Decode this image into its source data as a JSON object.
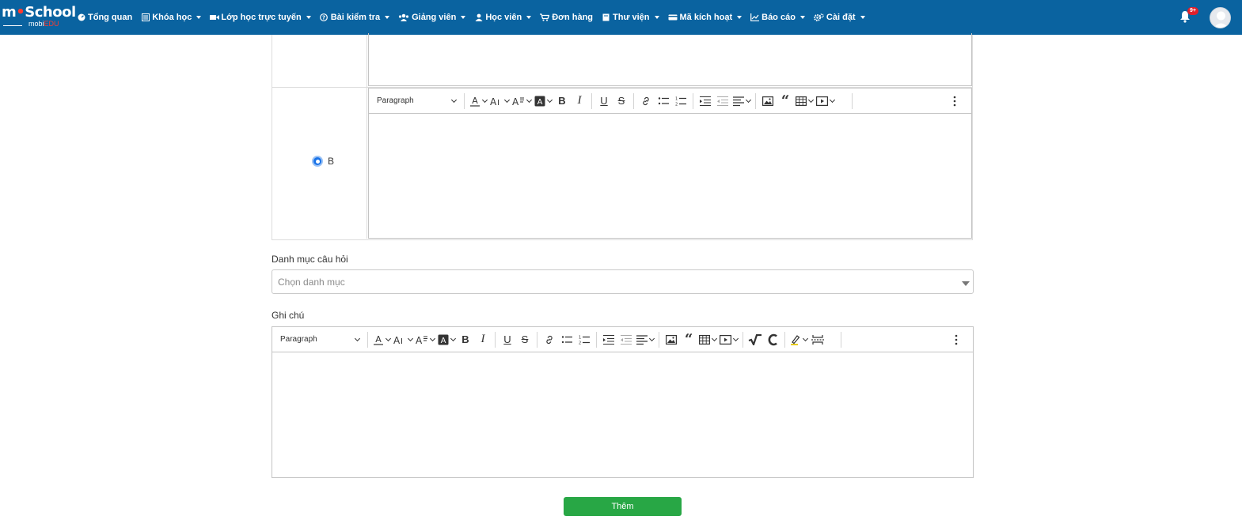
{
  "brand": {
    "logo_main_a": "m",
    "logo_main_dot": "•",
    "logo_main_b": "School",
    "logo_sub_a": "mobi",
    "logo_sub_b": "EDU"
  },
  "nav": {
    "items": [
      {
        "label": "Tổng quan",
        "icon": "dashboard-icon",
        "caret": false
      },
      {
        "label": "Khóa học",
        "icon": "list-icon",
        "caret": true
      },
      {
        "label": "Lớp học trực tuyến",
        "icon": "video-icon",
        "caret": true
      },
      {
        "label": "Bài kiểm tra",
        "icon": "question-icon",
        "caret": true
      },
      {
        "label": "Giảng viên",
        "icon": "users-icon",
        "caret": true
      },
      {
        "label": "Học viên",
        "icon": "user-icon",
        "caret": true
      },
      {
        "label": "Đơn hàng",
        "icon": "cart-icon",
        "caret": false
      },
      {
        "label": "Thư viện",
        "icon": "book-icon",
        "caret": true
      },
      {
        "label": "Mã kích hoạt",
        "icon": "card-icon",
        "caret": true
      },
      {
        "label": "Báo cáo",
        "icon": "chart-icon",
        "caret": true
      },
      {
        "label": "Cài đặt",
        "icon": "cogs-icon",
        "caret": true
      }
    ],
    "notification_badge": "9+"
  },
  "answer_b": {
    "radio_label": "B",
    "selected": true
  },
  "editor": {
    "paragraph_label": "Paragraph"
  },
  "category": {
    "label": "Danh mục câu hỏi",
    "placeholder": "Chọn danh mục"
  },
  "note": {
    "label": "Ghi chú"
  },
  "submit": {
    "label": "Thêm"
  },
  "colors": {
    "navbar": "#0a63a0",
    "submit": "#28a745",
    "radio": "#1a73e8",
    "badge": "#e0202b"
  }
}
